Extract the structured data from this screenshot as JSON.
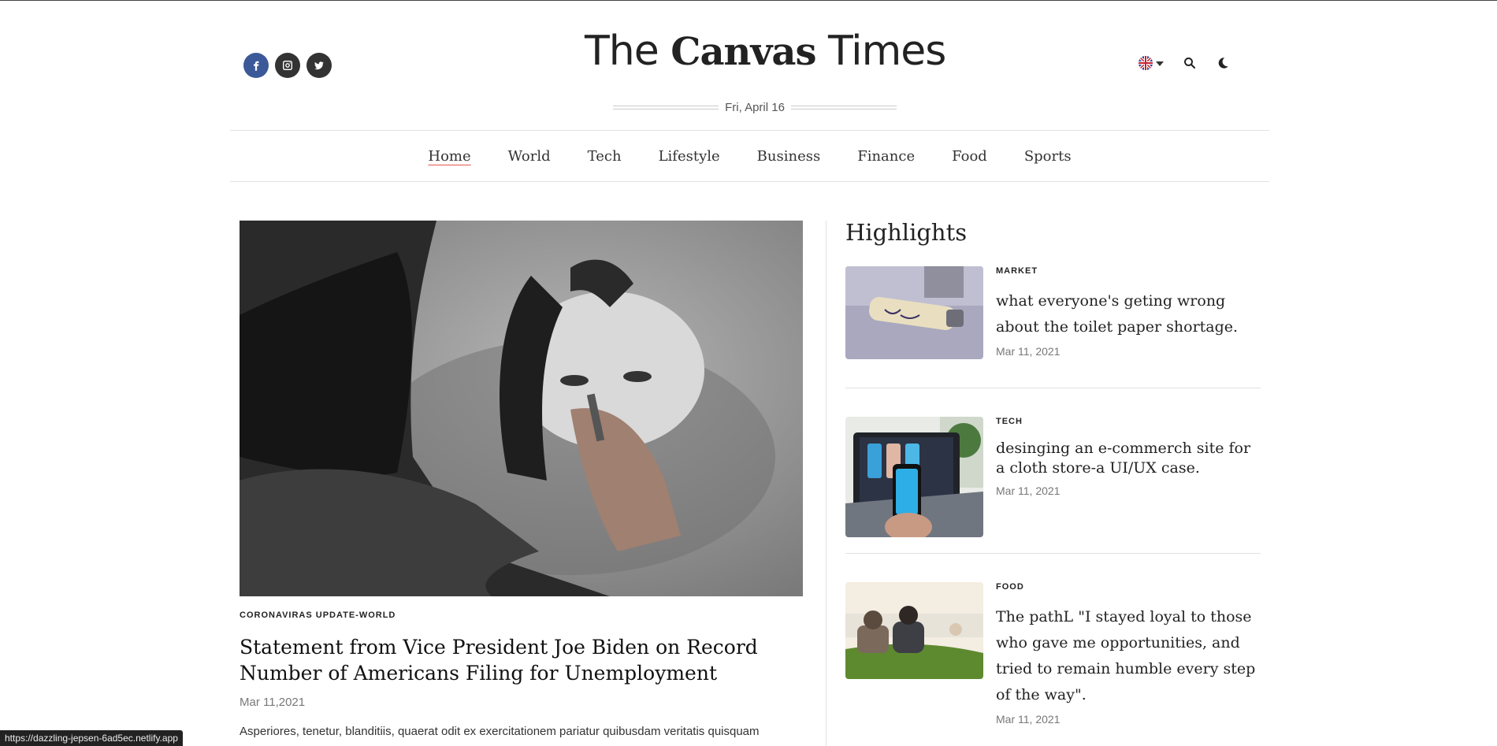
{
  "site": {
    "logo_pre": "The",
    "logo_bold": "Canvas",
    "logo_post": "Times",
    "date": "Fri, April 16"
  },
  "icons": {
    "facebook": "facebook-icon",
    "instagram": "instagram-icon",
    "twitter": "twitter-icon",
    "flag": "uk-flag-icon",
    "search": "search-icon",
    "theme": "moon-icon"
  },
  "colors": {
    "accent": "#e4554f",
    "facebook": "#3b5998"
  },
  "nav": {
    "items": [
      "Home",
      "World",
      "Tech",
      "Lifestyle",
      "Business",
      "Finance",
      "Food",
      "Sports"
    ],
    "active": "Home"
  },
  "main": {
    "kicker": "CORONAVIRAS UPDATE-WORLD",
    "headline": "Statement from Vice President Joe Biden on Record Number of Americans Filing for Unemployment",
    "date": "Mar 11,2021",
    "excerpt": "Asperiores, tenetur, blanditiis, quaerat odit ex exercitationem pariatur quibusdam veritatis quisquam"
  },
  "highlights": {
    "title": "Highlights",
    "items": [
      {
        "category": "MARKET",
        "title": "what everyone's geting wrong about the toilet paper shortage.",
        "date": "Mar 11, 2021"
      },
      {
        "category": "TECH",
        "title": "desinging an e-commerch site for a cloth store-a UI/UX case.",
        "date": "Mar 11, 2021"
      },
      {
        "category": "FOOD",
        "title": "The pathL \"I stayed loyal to those who gave me opportunities, and tried to remain humble every step of the way\".",
        "date": "Mar 11, 2021"
      }
    ]
  },
  "status_bar": {
    "url": "https://dazzling-jepsen-6ad5ec.netlify.app"
  }
}
